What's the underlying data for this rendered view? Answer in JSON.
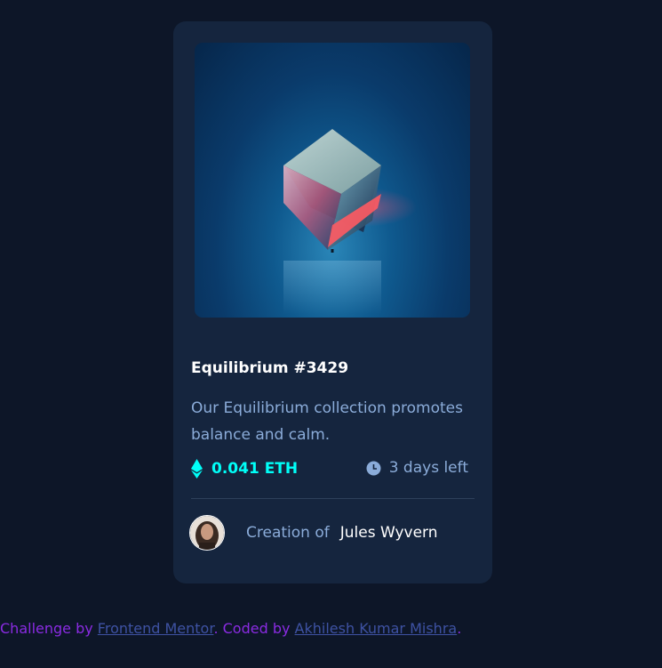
{
  "card": {
    "image_alt": "Equilibrium",
    "title": "Equilibrium #3429",
    "description": "Our Equilibrium collection promotes balance and calm.",
    "price": "0.041 ETH",
    "time_left": "3 days left",
    "creation_label": "Creation of",
    "creator_name": "Jules Wyvern",
    "icons": {
      "price": "ethereum-icon",
      "time": "clock-icon"
    }
  },
  "attribution": {
    "prefix": "Challenge by ",
    "challenge_link": "Frontend Mentor",
    "middle": ". Coded by ",
    "author_link": "Akhilesh Kumar Mishra",
    "suffix": "."
  },
  "colors": {
    "page_bg": "#0d1628",
    "card_bg": "#15253e",
    "cyan": "#00fff8",
    "soft_blue": "#8bacd9",
    "white": "#ffffff",
    "violet": "#8a2be2",
    "link_blue": "#3e52a3"
  }
}
